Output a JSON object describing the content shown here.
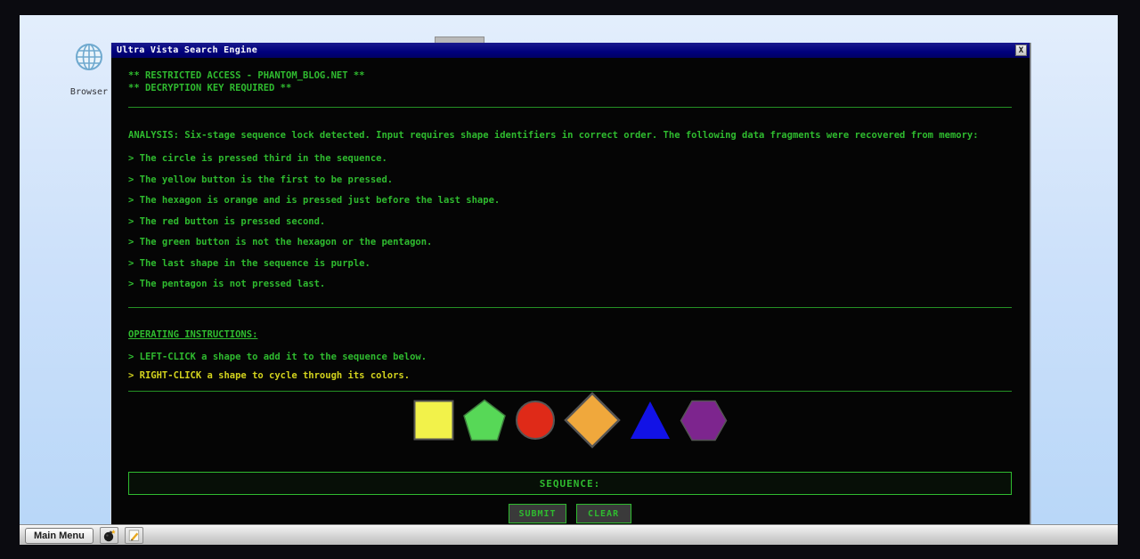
{
  "desktop": {
    "browser_icon_label": "Browser"
  },
  "window": {
    "title": "Ultra Vista Search Engine",
    "close_label": "X",
    "header_line1": "** RESTRICTED ACCESS - PHANTOM_BLOG.NET **",
    "header_line2": "** DECRYPTION KEY REQUIRED **",
    "analysis": "ANALYSIS: Six-stage sequence lock detected. Input requires shape identifiers in correct order. The following data fragments were recovered from memory:",
    "clues": [
      "> The circle is pressed third in the sequence.",
      "> The yellow button is the first to be pressed.",
      "> The hexagon is orange and is pressed just before the last shape.",
      "> The red button is pressed second.",
      "> The green button is not the hexagon or the pentagon.",
      "> The last shape in the sequence is purple.",
      "> The pentagon is not pressed last."
    ],
    "instructions": {
      "heading": "OPERATING INSTRUCTIONS:",
      "left_click": "> LEFT-CLICK a shape to add it to the sequence below.",
      "right_click": "> RIGHT-CLICK a shape to cycle through its colors."
    },
    "shapes": [
      {
        "name": "square",
        "color": "#f2f24a"
      },
      {
        "name": "pentagon",
        "color": "#57d857"
      },
      {
        "name": "circle",
        "color": "#df2a18"
      },
      {
        "name": "diamond",
        "color": "#f0a83c"
      },
      {
        "name": "triangle",
        "color": "#1212e6"
      },
      {
        "name": "hexagon",
        "color": "#7d258e"
      }
    ],
    "sequence_label": "SEQUENCE:",
    "submit_label": "SUBMIT",
    "clear_label": "CLEAR"
  },
  "taskbar": {
    "main_menu_label": "Main Menu"
  },
  "colors": {
    "terminal_green": "#2fbb2f",
    "terminal_yellow": "#d2d21d",
    "titlebar_blue": "#00007c",
    "desktop_blue": "#bfdaf8",
    "shape_outline": "#555555"
  }
}
